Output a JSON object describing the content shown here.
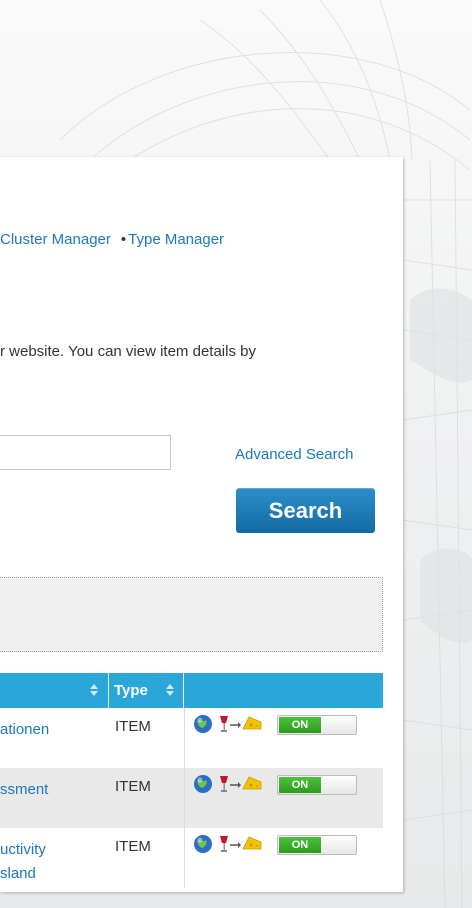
{
  "nav": {
    "cluster_manager": "Cluster Manager",
    "separator": "•",
    "type_manager": "Type Manager"
  },
  "intro_text": "r website. You can view item details by",
  "search": {
    "input_value": "",
    "advanced_label": "Advanced Search",
    "button_label": "Search"
  },
  "table": {
    "type_header": "Type",
    "rows": [
      {
        "title_line1": "ationen",
        "title_line2": "",
        "type": "ITEM",
        "toggle": "ON"
      },
      {
        "title_line1": "ssment",
        "title_line2": "",
        "type": "ITEM",
        "toggle": "ON"
      },
      {
        "title_line1": "uctivity",
        "title_line2": "sland",
        "type": "ITEM",
        "toggle": "ON"
      }
    ]
  },
  "colors": {
    "link": "#1a79bd",
    "header_bg": "#2aa6d8",
    "button_bg": "#1e7fbd",
    "toggle_on": "#3bb02b"
  },
  "icons": [
    "globe-icon",
    "wine-glass-icon",
    "arrow-icon",
    "cheese-icon"
  ]
}
